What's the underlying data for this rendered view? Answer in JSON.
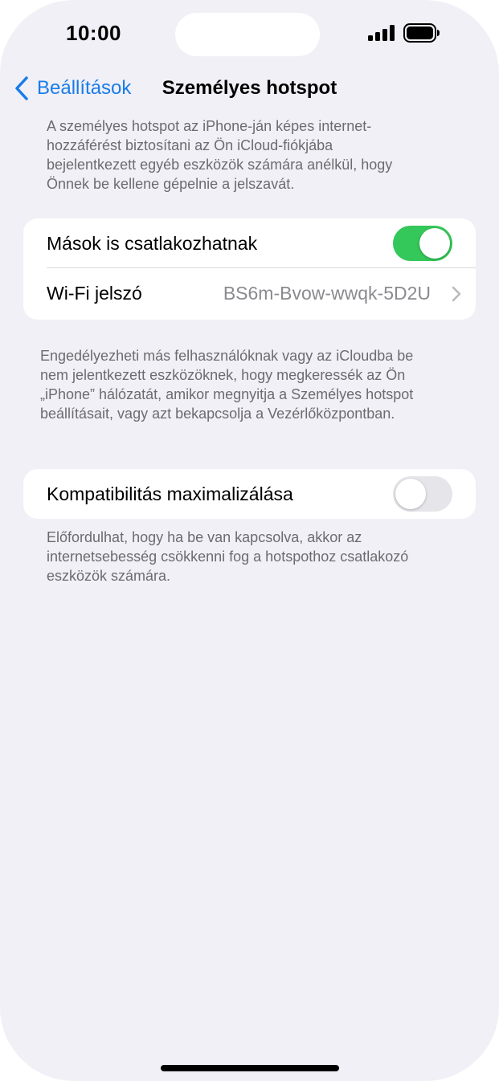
{
  "status_bar": {
    "time": "10:00",
    "signal_icon": "cellular-signal-icon",
    "battery_icon": "battery-icon"
  },
  "nav": {
    "back_label": "Beállítások",
    "back_icon": "chevron-left-icon",
    "title": "Személyes hotspot",
    "accent_color": "#1a7ce8"
  },
  "intro_note": "A személyes hotspot az iPhone-ján képes internet-\nhozzáférést biztosítani az Ön iCloud-fiókjába\nbejelentkezett egyéb eszközök számára anélkül, hogy\nÖnnek be kellene gépelnie a jelszavát.",
  "group_1": {
    "allow_others": {
      "label": "Mások is csatlakozhatnak",
      "enabled": true
    },
    "wifi_password": {
      "label": "Wi-Fi jelszó",
      "value": "BS6m-Bvow-wwqk-5D2U",
      "icon": "chevron-right-icon"
    }
  },
  "group_1_note": "Engedélyezheti más felhasználóknak vagy az iCloudba be\nnem jelentkezett eszközöknek, hogy megkeressék az Ön\n„iPhone” hálózatát, amikor megnyitja a Személyes hotspot\nbeállításait, vagy azt bekapcsolja a Vezérlőközpontban.",
  "group_2": {
    "maximize_compatibility": {
      "label": "Kompatibilitás maximalizálása",
      "enabled": false
    }
  },
  "group_2_note": "Előfordulhat, hogy ha be van kapcsolva, akkor az\ninternetsebesség csökkenni fog a hotspothoz csatlakozó\neszközök számára.",
  "colors": {
    "toggle_on": "#34c759",
    "background": "#f0f0f6"
  }
}
